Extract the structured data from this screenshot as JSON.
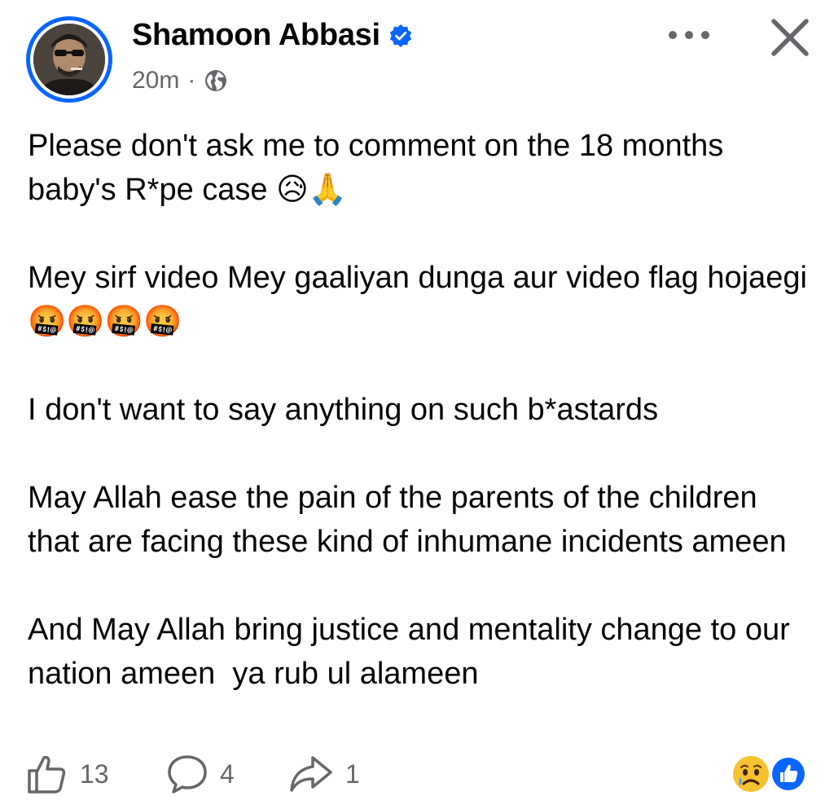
{
  "post": {
    "author": "Shamoon Abbasi",
    "verified": true,
    "time": "20m",
    "separator": "·",
    "privacy_icon": "globe-icon",
    "paragraphs": [
      "Please don't ask me to comment on the 18 months baby's R*pe case 😥🙏",
      "Mey sirf video Mey gaaliyan dunga aur video flag hojaegi 🤬🤬🤬🤬",
      "I don't want to say anything on such b*astards",
      "May Allah ease the pain of the parents of the children that are facing these kind of inhumane incidents ameen",
      "And May Allah bring justice and mentality change to our nation ameen  ya rub ul alameen"
    ]
  },
  "header_actions": {
    "more_icon": "more-dots-icon",
    "close_icon": "close-icon"
  },
  "footer": {
    "likes": "13",
    "comments": "4",
    "shares": "1",
    "reactions": [
      "sad-reaction-icon",
      "like-reaction-icon"
    ]
  },
  "colors": {
    "accent": "#0866ff",
    "secondary_text": "#65676b",
    "text": "#050505"
  }
}
